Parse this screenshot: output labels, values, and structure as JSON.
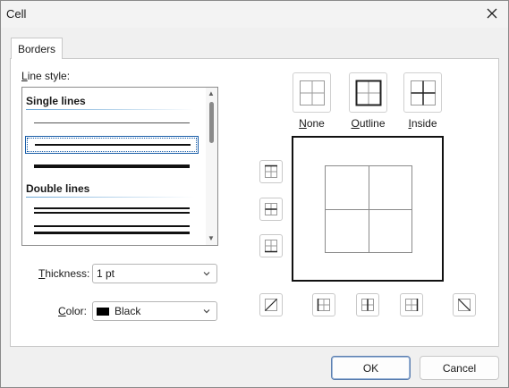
{
  "window": {
    "title": "Cell"
  },
  "tabs": [
    {
      "label": "Borders"
    }
  ],
  "line_style": {
    "label": "Line style:",
    "groups": [
      {
        "header": "Single lines"
      },
      {
        "header": "Double lines"
      }
    ],
    "selected_index": 1
  },
  "thickness": {
    "label": "Thickness:",
    "value": "1 pt"
  },
  "color": {
    "label": "Color:",
    "value": "Black",
    "swatch": "#000000"
  },
  "presets": [
    {
      "label": "None",
      "icon": "no-border-icon"
    },
    {
      "label": "Outline",
      "icon": "outline-border-icon"
    },
    {
      "label": "Inside",
      "icon": "inside-border-icon"
    }
  ],
  "buttons": {
    "ok": "OK",
    "cancel": "Cancel"
  }
}
